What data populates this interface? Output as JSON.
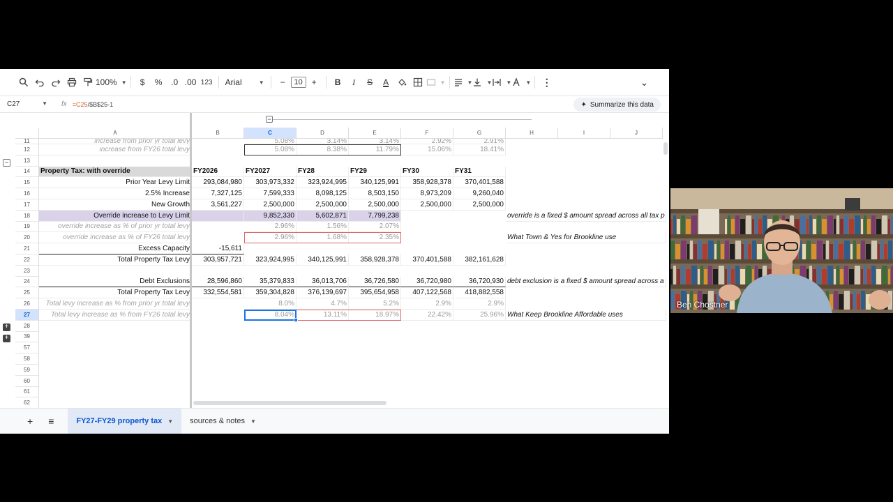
{
  "toolbar": {
    "zoom": "100%",
    "currency": "$",
    "percent": "%",
    "dec_decrease": ".0",
    "dec_increase": ".00",
    "number_format": "123",
    "font": "Arial",
    "font_size": "10",
    "minus": "−",
    "plus": "+",
    "bold": "B",
    "italic": "I",
    "strike": "S",
    "textcolor": "A",
    "more": "⋮",
    "collapse": "⌄"
  },
  "formula_bar": {
    "cell_ref": "C27",
    "fx": "fx",
    "formula_part1": "=C25",
    "formula_part2": "/$B$25-1",
    "summarize_label": "Summarize this data"
  },
  "columns": [
    "A",
    "B",
    "C",
    "D",
    "E",
    "F",
    "G",
    "H",
    "I",
    "J"
  ],
  "rows": [
    {
      "num": "11",
      "A": "increase from prior yr total levy",
      "C": "5.08%",
      "D": "3.14%",
      "E": "3.14%",
      "F": "2.92%",
      "G": "2.91%"
    },
    {
      "num": "12",
      "A": "increase from FY26 total levy",
      "C": "5.08%",
      "D": "8.38%",
      "E": "11.79%",
      "F": "15.06%",
      "G": "18.41%"
    },
    {
      "num": "13"
    },
    {
      "num": "14",
      "A": "Property Tax: with override",
      "B": "FY2026",
      "C": "FY2027",
      "D": "FY28",
      "E": "FY29",
      "F": "FY30",
      "G": "FY31"
    },
    {
      "num": "15",
      "A": "Prior Year Levy Limit",
      "B": "293,084,980",
      "C": "303,973,332",
      "D": "323,924,995",
      "E": "340,125,991",
      "F": "358,928,378",
      "G": "370,401,588"
    },
    {
      "num": "16",
      "A": "2.5% Increase",
      "B": "7,327,125",
      "C": "7,599,333",
      "D": "8,098,125",
      "E": "8,503,150",
      "F": "8,973,209",
      "G": "9,260,040"
    },
    {
      "num": "17",
      "A": "New Growth",
      "B": "3,561,227",
      "C": "2,500,000",
      "D": "2,500,000",
      "E": "2,500,000",
      "F": "2,500,000",
      "G": "2,500,000"
    },
    {
      "num": "18",
      "A": "Override increase to Levy Limit",
      "C": "9,852,330",
      "D": "5,602,871",
      "E": "7,799,238",
      "H": "override is a fixed $ amount spread across all tax p"
    },
    {
      "num": "19",
      "A": "override increase as % of prior yr total levy",
      "C": "2.96%",
      "D": "1.56%",
      "E": "2.07%"
    },
    {
      "num": "20",
      "A": "override increase as % of FY26 total levy",
      "C": "2.96%",
      "D": "1.68%",
      "E": "2.35%",
      "H": "What Town & Yes for Brookline use"
    },
    {
      "num": "21",
      "A": "Excess Capacity",
      "B": "-15,611"
    },
    {
      "num": "22",
      "A": "Total Property Tax Levy",
      "B": "303,957,721",
      "C": "323,924,995",
      "D": "340,125,991",
      "E": "358,928,378",
      "F": "370,401,588",
      "G": "382,161,628"
    },
    {
      "num": "23"
    },
    {
      "num": "24",
      "A": "Debt Exclusions",
      "B": "28,596,860",
      "C": "35,379,833",
      "D": "36,013,706",
      "E": "36,726,580",
      "F": "36,720,980",
      "G": "36,720,930",
      "H": "debt exclusion is a fixed $ amount spread across a"
    },
    {
      "num": "25",
      "A": "Total Property Tax Levy",
      "B": "332,554,581",
      "C": "359,304,828",
      "D": "376,139,697",
      "E": "395,654,958",
      "F": "407,122,568",
      "G": "418,882,558"
    },
    {
      "num": "26",
      "A": "Total levy increase as % from prior yr total levy",
      "C": "8.0%",
      "D": "4.7%",
      "E": "5.2%",
      "F": "2.9%",
      "G": "2.9%"
    },
    {
      "num": "27",
      "A": "Total levy increase as % from FY26 total levy",
      "C": "8.04%",
      "D": "13.11%",
      "E": "18.97%",
      "F": "22.42%",
      "G": "25.96%",
      "H": "What Keep Brookline Affordable uses"
    },
    {
      "num": "28"
    },
    {
      "num": "39"
    },
    {
      "num": "57"
    },
    {
      "num": "58"
    },
    {
      "num": "59"
    },
    {
      "num": "60"
    },
    {
      "num": "61"
    },
    {
      "num": "62"
    }
  ],
  "sheet_tabs": {
    "add": "+",
    "all_sheets": "≡",
    "tab1": "FY27-FY29 property tax",
    "tab2": "sources & notes"
  },
  "webcam": {
    "participant_name": "Ben Chostner"
  },
  "colors": {
    "selection": "#1a73e8",
    "purple_fill": "#d9d2e9",
    "header_fill": "#d9d9d9",
    "red_outline": "#e06666"
  }
}
